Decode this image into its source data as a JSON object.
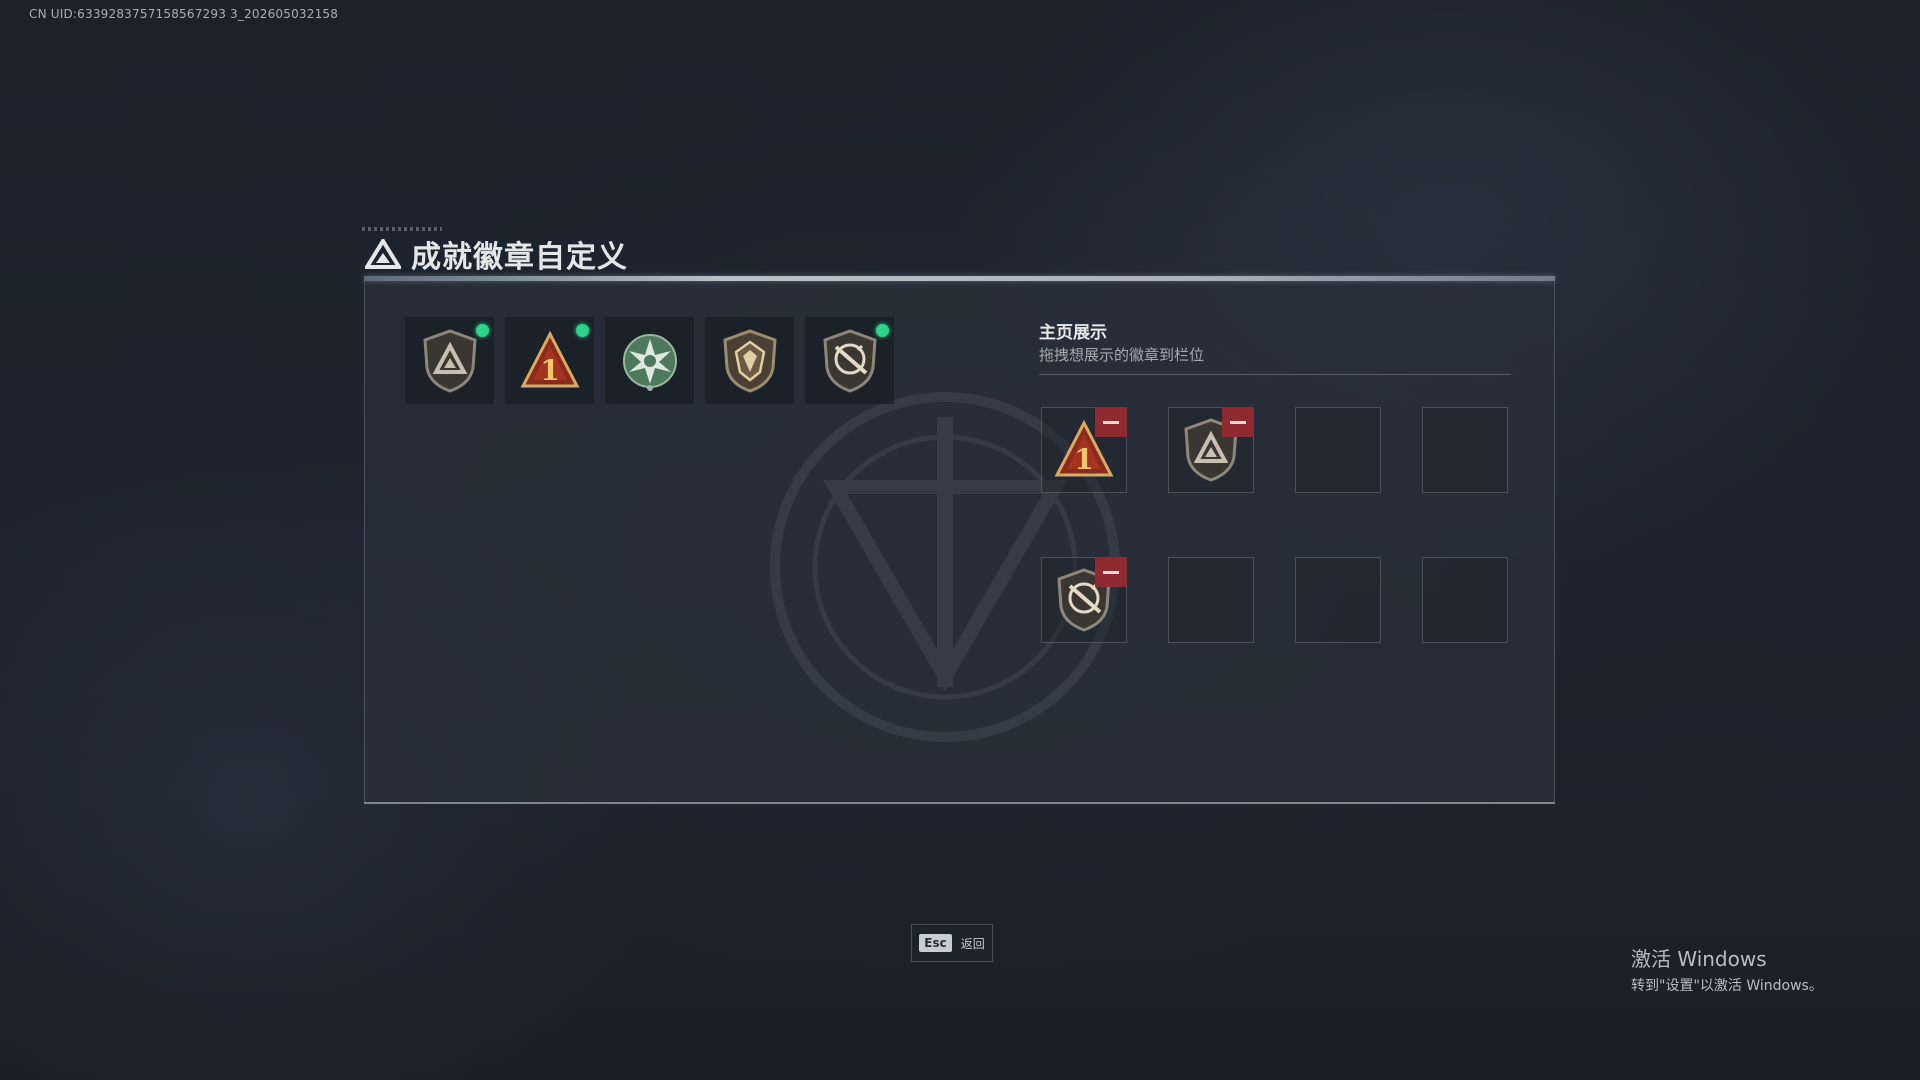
{
  "uid_text": "CN UID:6339283757158567293 3_202605032158",
  "title": "成就徽章自定义",
  "badges": [
    {
      "icon": "shield-triangle-badge-icon",
      "has_dot": true
    },
    {
      "icon": "number-one-triangle-badge-icon",
      "has_dot": true
    },
    {
      "icon": "green-star-medal-badge-icon",
      "has_dot": false
    },
    {
      "icon": "shield-gem-badge-icon",
      "has_dot": false
    },
    {
      "icon": "shield-compass-badge-icon",
      "has_dot": true
    }
  ],
  "showcase": {
    "title": "主页展示",
    "subtitle": "拖拽想展示的徽章到栏位",
    "slots": [
      {
        "badge": "number-one-triangle-badge-icon"
      },
      {
        "badge": "shield-triangle-badge-icon"
      },
      {
        "badge": null
      },
      {
        "badge": null
      },
      {
        "badge": "shield-compass-badge-icon"
      },
      {
        "badge": null
      },
      {
        "badge": null
      },
      {
        "badge": null
      }
    ]
  },
  "footer": {
    "esc_key": "Esc",
    "esc_label": "返回"
  },
  "windows": {
    "line1": "激活 Windows",
    "line2": "转到\"设置\"以激活 Windows。"
  },
  "colors": {
    "indicator_dot": "#2ed38a",
    "remove_button": "#8f2a30"
  }
}
